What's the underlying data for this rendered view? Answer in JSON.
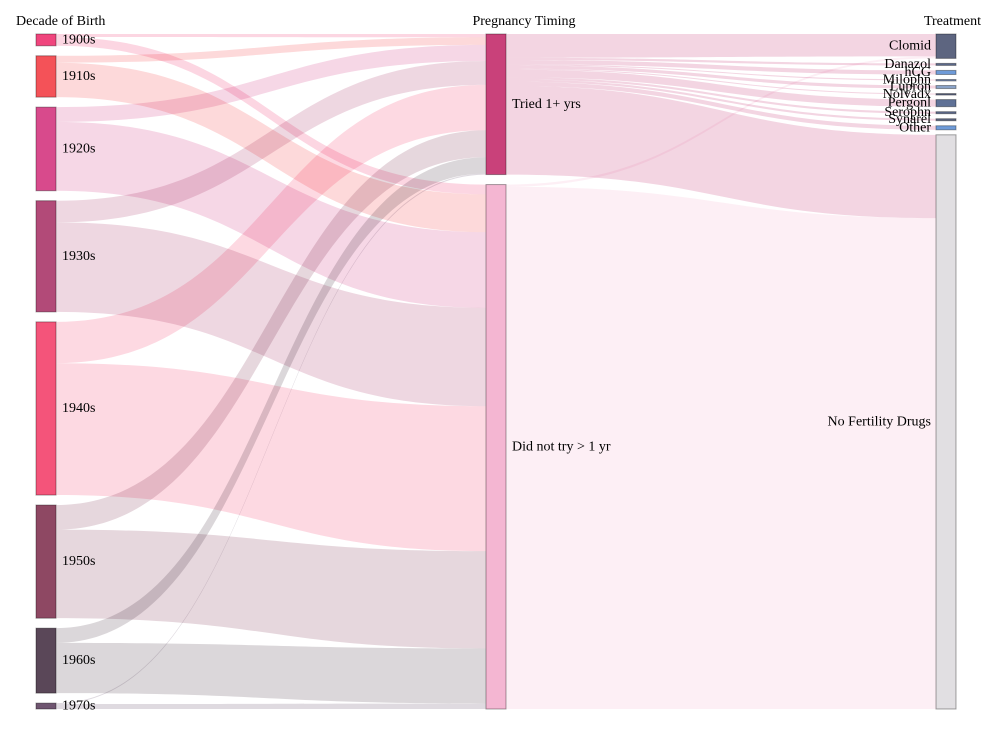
{
  "chart_data": {
    "type": "sankey",
    "columns": [
      {
        "id": "decade",
        "title": "Decade of Birth"
      },
      {
        "id": "timing",
        "title": "Pregnancy Timing"
      },
      {
        "id": "treatment",
        "title": "Treatment"
      }
    ],
    "nodes": [
      {
        "id": "d1900",
        "label": "1900s",
        "column": "decade",
        "value": 12,
        "color": "#f0457d"
      },
      {
        "id": "d1910",
        "label": "1910s",
        "column": "decade",
        "value": 42,
        "color": "#f45258"
      },
      {
        "id": "d1920",
        "label": "1920s",
        "column": "decade",
        "value": 85,
        "color": "#d84a8c"
      },
      {
        "id": "d1930",
        "label": "1930s",
        "column": "decade",
        "value": 113,
        "color": "#b24a78"
      },
      {
        "id": "d1940",
        "label": "1940s",
        "column": "decade",
        "value": 176,
        "color": "#f4547a"
      },
      {
        "id": "d1950",
        "label": "1950s",
        "column": "decade",
        "value": 115,
        "color": "#8e4863"
      },
      {
        "id": "d1960",
        "label": "1960s",
        "column": "decade",
        "value": 66,
        "color": "#5a4758"
      },
      {
        "id": "d1970",
        "label": "1970s",
        "column": "decade",
        "value": 6,
        "color": "#6f5570"
      },
      {
        "id": "tried",
        "label": "Tried 1+ yrs",
        "column": "timing",
        "value": 130,
        "color": "#c9417a"
      },
      {
        "id": "notry",
        "label": "Did not try > 1 yr",
        "column": "timing",
        "value": 485,
        "color": "#f4b6d2"
      },
      {
        "id": "clomid",
        "label": "Clomid",
        "column": "treatment",
        "value": 24,
        "color": "#5d6580"
      },
      {
        "id": "danazol",
        "label": "Danazol",
        "column": "treatment",
        "value": 2,
        "color": "#5d6a8c"
      },
      {
        "id": "hcg",
        "label": "hCG",
        "column": "treatment",
        "value": 4,
        "color": "#6f9bd8"
      },
      {
        "id": "milophn",
        "label": "Milophn",
        "column": "treatment",
        "value": 1,
        "color": "#7a8ab0"
      },
      {
        "id": "lupron",
        "label": "Lupron",
        "column": "treatment",
        "value": 3,
        "color": "#8aa3c8"
      },
      {
        "id": "nolvadx",
        "label": "Nolvadx",
        "column": "treatment",
        "value": 1,
        "color": "#5d6580"
      },
      {
        "id": "pergonl",
        "label": "Pergonl",
        "column": "treatment",
        "value": 7,
        "color": "#5f7196"
      },
      {
        "id": "serophn",
        "label": "Serophn",
        "column": "treatment",
        "value": 2,
        "color": "#5d6a8c"
      },
      {
        "id": "synarel",
        "label": "Synarel",
        "column": "treatment",
        "value": 2,
        "color": "#5d6580"
      },
      {
        "id": "other",
        "label": "Other",
        "column": "treatment",
        "value": 4,
        "color": "#6f9bd8"
      },
      {
        "id": "nofert",
        "label": "No Fertility Drugs",
        "column": "treatment",
        "value": 565,
        "color": "#e1dfe2"
      }
    ],
    "links": [
      {
        "source": "d1900",
        "target": "tried",
        "value": 3
      },
      {
        "source": "d1900",
        "target": "notry",
        "value": 9
      },
      {
        "source": "d1910",
        "target": "tried",
        "value": 7
      },
      {
        "source": "d1910",
        "target": "notry",
        "value": 35
      },
      {
        "source": "d1920",
        "target": "tried",
        "value": 15
      },
      {
        "source": "d1920",
        "target": "notry",
        "value": 70
      },
      {
        "source": "d1930",
        "target": "tried",
        "value": 22
      },
      {
        "source": "d1930",
        "target": "notry",
        "value": 91
      },
      {
        "source": "d1940",
        "target": "tried",
        "value": 42
      },
      {
        "source": "d1940",
        "target": "notry",
        "value": 134
      },
      {
        "source": "d1950",
        "target": "tried",
        "value": 25
      },
      {
        "source": "d1950",
        "target": "notry",
        "value": 90
      },
      {
        "source": "d1960",
        "target": "tried",
        "value": 15
      },
      {
        "source": "d1960",
        "target": "notry",
        "value": 51
      },
      {
        "source": "d1970",
        "target": "tried",
        "value": 1
      },
      {
        "source": "d1970",
        "target": "notry",
        "value": 5
      },
      {
        "source": "tried",
        "target": "clomid",
        "value": 22
      },
      {
        "source": "tried",
        "target": "danazol",
        "value": 2
      },
      {
        "source": "tried",
        "target": "hcg",
        "value": 4
      },
      {
        "source": "tried",
        "target": "milophn",
        "value": 1
      },
      {
        "source": "tried",
        "target": "lupron",
        "value": 3
      },
      {
        "source": "tried",
        "target": "nolvadx",
        "value": 1
      },
      {
        "source": "tried",
        "target": "pergonl",
        "value": 7
      },
      {
        "source": "tried",
        "target": "serophn",
        "value": 2
      },
      {
        "source": "tried",
        "target": "synarel",
        "value": 2
      },
      {
        "source": "tried",
        "target": "other",
        "value": 4
      },
      {
        "source": "tried",
        "target": "nofert",
        "value": 82
      },
      {
        "source": "notry",
        "target": "clomid",
        "value": 2
      },
      {
        "source": "notry",
        "target": "nofert",
        "value": 483
      }
    ]
  }
}
